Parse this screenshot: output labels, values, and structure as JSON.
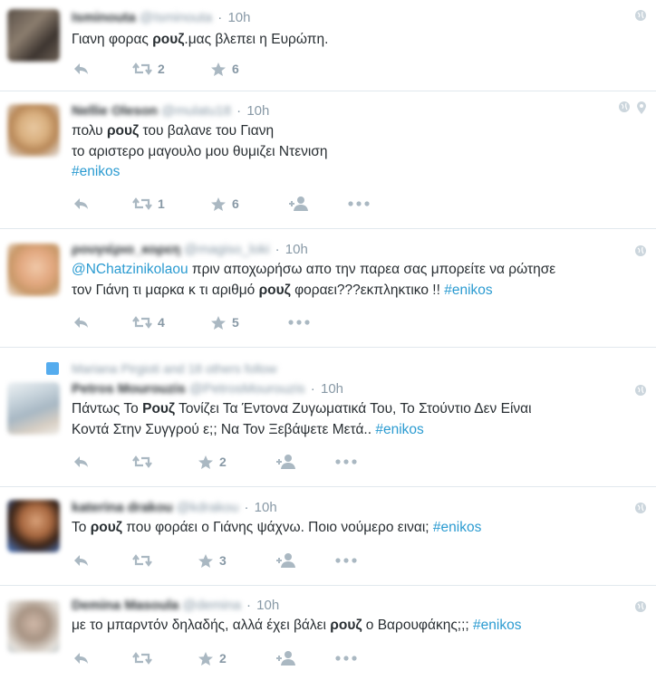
{
  "colors": {
    "link": "#2b9bd1",
    "icon": "#aab8c2",
    "meta": "#8899a6",
    "text": "#292f33",
    "divider": "#e1e8ed"
  },
  "tweets": [
    {
      "name": "Isminouta",
      "handle": "@Isminouta",
      "time": "10h",
      "segments": [
        [
          "Γιανη φορας ",
          ""
        ],
        [
          "ρουζ",
          "b"
        ],
        [
          ".μας βλεπει η Ευρώπη.",
          ""
        ]
      ],
      "retweets": "2",
      "favorites": "6"
    },
    {
      "name": "Nellie Oleson",
      "handle": "@mulatu18",
      "time": "10h",
      "lines": [
        [
          [
            "πολυ ",
            ""
          ],
          [
            "ρουζ",
            "b"
          ],
          [
            " του βαλανε του Γιανη",
            ""
          ]
        ],
        [
          [
            "το αριστερο μαγουλο μου θυμιζει Ντενιση",
            ""
          ]
        ],
        [
          [
            "#enikos",
            "tag"
          ]
        ]
      ],
      "retweets": "1",
      "favorites": "6"
    },
    {
      "name": "ρουγιέριο_κορεη",
      "handle": "@magiso_loki",
      "time": "10h",
      "lines": [
        [
          [
            "@NChatzinikolaou",
            "tag"
          ],
          [
            " πριν αποχωρήσω απο την παρεα σας μπορείτε να ρώτησε",
            ""
          ]
        ],
        [
          [
            "τον Γιάνη τι μαρκα κ τι αριθμό ",
            ""
          ],
          [
            "ρουζ",
            "b"
          ],
          [
            " φοραει???εκπληκτικο !! ",
            ""
          ],
          [
            "#enikos",
            "tag"
          ]
        ]
      ],
      "retweets": "4",
      "favorites": "5"
    },
    {
      "social": "Mariana Pirgioti and 18 others follow",
      "name": "Petros Mourouzis",
      "handle": "@PetrosMourouzis",
      "time": "10h",
      "lines": [
        [
          [
            "Πάντως Το ",
            ""
          ],
          [
            "Ρουζ",
            "b"
          ],
          [
            " Τονίζει Τα Έντονα Ζυγωματικά Του, Το Στούντιο Δεν Είναι",
            ""
          ]
        ],
        [
          [
            "Κοντά Στην Συγγρού ε;; Να Τον Ξεβάψετε Μετά.. ",
            ""
          ],
          [
            "#enikos",
            "tag"
          ]
        ]
      ],
      "retweets": "",
      "favorites": "2"
    },
    {
      "name": "katerina drakou",
      "handle": "@kdrakou",
      "time": "10h",
      "lines": [
        [
          [
            "Το ",
            ""
          ],
          [
            "ρουζ",
            "b"
          ],
          [
            " που φοράει ο Γιάνης ψάχνω. Ποιο νούμερο ειναι; ",
            ""
          ],
          [
            "#enikos",
            "tag"
          ]
        ]
      ],
      "retweets": "",
      "favorites": "3"
    },
    {
      "name": "Demina Masoula",
      "handle": "@demina",
      "time": "10h",
      "lines": [
        [
          [
            "με το μπαρντόν δηλαδής, αλλά έχει βάλει ",
            ""
          ],
          [
            "ρουζ",
            "b"
          ],
          [
            " ο Βαρουφάκης;;; ",
            ""
          ],
          [
            "#enikos",
            "tag"
          ]
        ]
      ],
      "retweets": "",
      "favorites": "2"
    }
  ]
}
